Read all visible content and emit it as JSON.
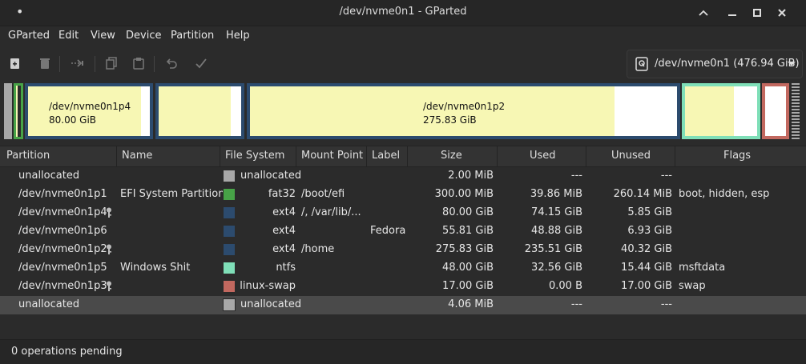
{
  "window": {
    "title": "/dev/nvme0n1 - GParted"
  },
  "menu": {
    "items": [
      "GParted",
      "Edit",
      "View",
      "Device",
      "Partition",
      "Help"
    ]
  },
  "toolbar": {
    "icons": [
      "new-partition-icon",
      "delete-icon",
      "resize-move-icon",
      "copy-icon",
      "paste-icon",
      "undo-icon",
      "apply-icon"
    ],
    "device": "/dev/nvme0n1 (476.94 GiB)"
  },
  "map": {
    "p4": {
      "name": "/dev/nvme0n1p4",
      "size": "80.00 GiB",
      "used_fraction": 0.927
    },
    "p6": {
      "used_fraction": 0.876
    },
    "p2": {
      "name": "/dev/nvme0n1p2",
      "size": "275.83 GiB",
      "used_fraction": 0.854
    },
    "p5": {
      "used_fraction": 0.678
    },
    "colors": {
      "ext4": "#2c4b6e",
      "fat32": "#47a347",
      "ntfs": "#7fdfb8",
      "linux_swap": "#c2685f",
      "unallocated": "#a8a8a8"
    }
  },
  "table": {
    "headers": [
      "Partition",
      "Name",
      "File System",
      "Mount Point",
      "Label",
      "Size",
      "Used",
      "Unused",
      "Flags"
    ],
    "rows": [
      {
        "partition": "unallocated",
        "name": "",
        "fs": "unallocated",
        "fs_color": "#a8a8a8",
        "mount": "",
        "label": "",
        "size": "2.00 MiB",
        "used": "---",
        "unused": "---",
        "flags": "",
        "key": false
      },
      {
        "partition": "/dev/nvme0n1p1",
        "name": "EFI System Partition",
        "fs": "fat32",
        "fs_color": "#47a347",
        "mount": "/boot/efi",
        "label": "",
        "size": "300.00 MiB",
        "used": "39.86 MiB",
        "unused": "260.14 MiB",
        "flags": "boot, hidden, esp",
        "key": false
      },
      {
        "partition": "/dev/nvme0n1p4",
        "name": "",
        "fs": "ext4",
        "fs_color": "#2c4b6e",
        "mount": "/, /var/lib/...",
        "label": "",
        "size": "80.00 GiB",
        "used": "74.15 GiB",
        "unused": "5.85 GiB",
        "flags": "",
        "key": true
      },
      {
        "partition": "/dev/nvme0n1p6",
        "name": "",
        "fs": "ext4",
        "fs_color": "#2c4b6e",
        "mount": "",
        "label": "Fedora",
        "size": "55.81 GiB",
        "used": "48.88 GiB",
        "unused": "6.93 GiB",
        "flags": "",
        "key": false
      },
      {
        "partition": "/dev/nvme0n1p2",
        "name": "",
        "fs": "ext4",
        "fs_color": "#2c4b6e",
        "mount": "/home",
        "label": "",
        "size": "275.83 GiB",
        "used": "235.51 GiB",
        "unused": "40.32 GiB",
        "flags": "",
        "key": true
      },
      {
        "partition": "/dev/nvme0n1p5",
        "name": "Windows Shit",
        "fs": "ntfs",
        "fs_color": "#7fdfb8",
        "mount": "",
        "label": "",
        "size": "48.00 GiB",
        "used": "32.56 GiB",
        "unused": "15.44 GiB",
        "flags": "msftdata",
        "key": false
      },
      {
        "partition": "/dev/nvme0n1p3",
        "name": "",
        "fs": "linux-swap",
        "fs_color": "#c2685f",
        "mount": "",
        "label": "",
        "size": "17.00 GiB",
        "used": "0.00 B",
        "unused": "17.00 GiB",
        "flags": "swap",
        "key": true
      },
      {
        "partition": "unallocated",
        "name": "",
        "fs": "unallocated",
        "fs_color": "#a8a8a8",
        "mount": "",
        "label": "",
        "size": "4.06 MiB",
        "used": "---",
        "unused": "---",
        "flags": "",
        "key": false
      }
    ]
  },
  "status": {
    "text": "0 operations pending"
  }
}
